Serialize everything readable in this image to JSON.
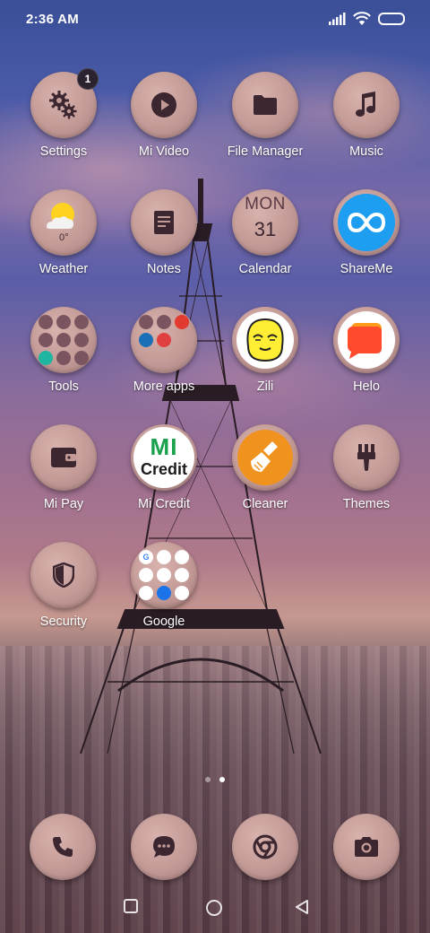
{
  "status_bar": {
    "time": "2:36 AM"
  },
  "apps": [
    {
      "label": "Settings",
      "badge": "1"
    },
    {
      "label": "Mi Video"
    },
    {
      "label": "File Manager"
    },
    {
      "label": "Music"
    },
    {
      "label": "Weather",
      "temperature": "0°"
    },
    {
      "label": "Notes"
    },
    {
      "label": "Calendar",
      "day": "MON",
      "date": "31"
    },
    {
      "label": "ShareMe"
    },
    {
      "label": "Tools"
    },
    {
      "label": "More apps"
    },
    {
      "label": "Zili"
    },
    {
      "label": "Helo"
    },
    {
      "label": "Mi Pay"
    },
    {
      "label": "Mi Credit",
      "icon_text_1": "MI",
      "icon_text_2": "Credit"
    },
    {
      "label": "Cleaner"
    },
    {
      "label": "Themes"
    },
    {
      "label": "Security"
    },
    {
      "label": "Google"
    }
  ],
  "dock": [
    {
      "icon": "phone-icon"
    },
    {
      "icon": "messages-icon"
    },
    {
      "icon": "chrome-icon"
    },
    {
      "icon": "camera-icon"
    }
  ],
  "page_indicator": {
    "pages": 2,
    "active": 1
  },
  "colors": {
    "icon_bg": "#c39a96",
    "glyph": "#3c2630",
    "shareme_blue": "#1e9ef0",
    "cleaner_orange": "#f0921e",
    "helo_orange": "#ff5a2a",
    "mi_credit_green": "#19a24b"
  }
}
